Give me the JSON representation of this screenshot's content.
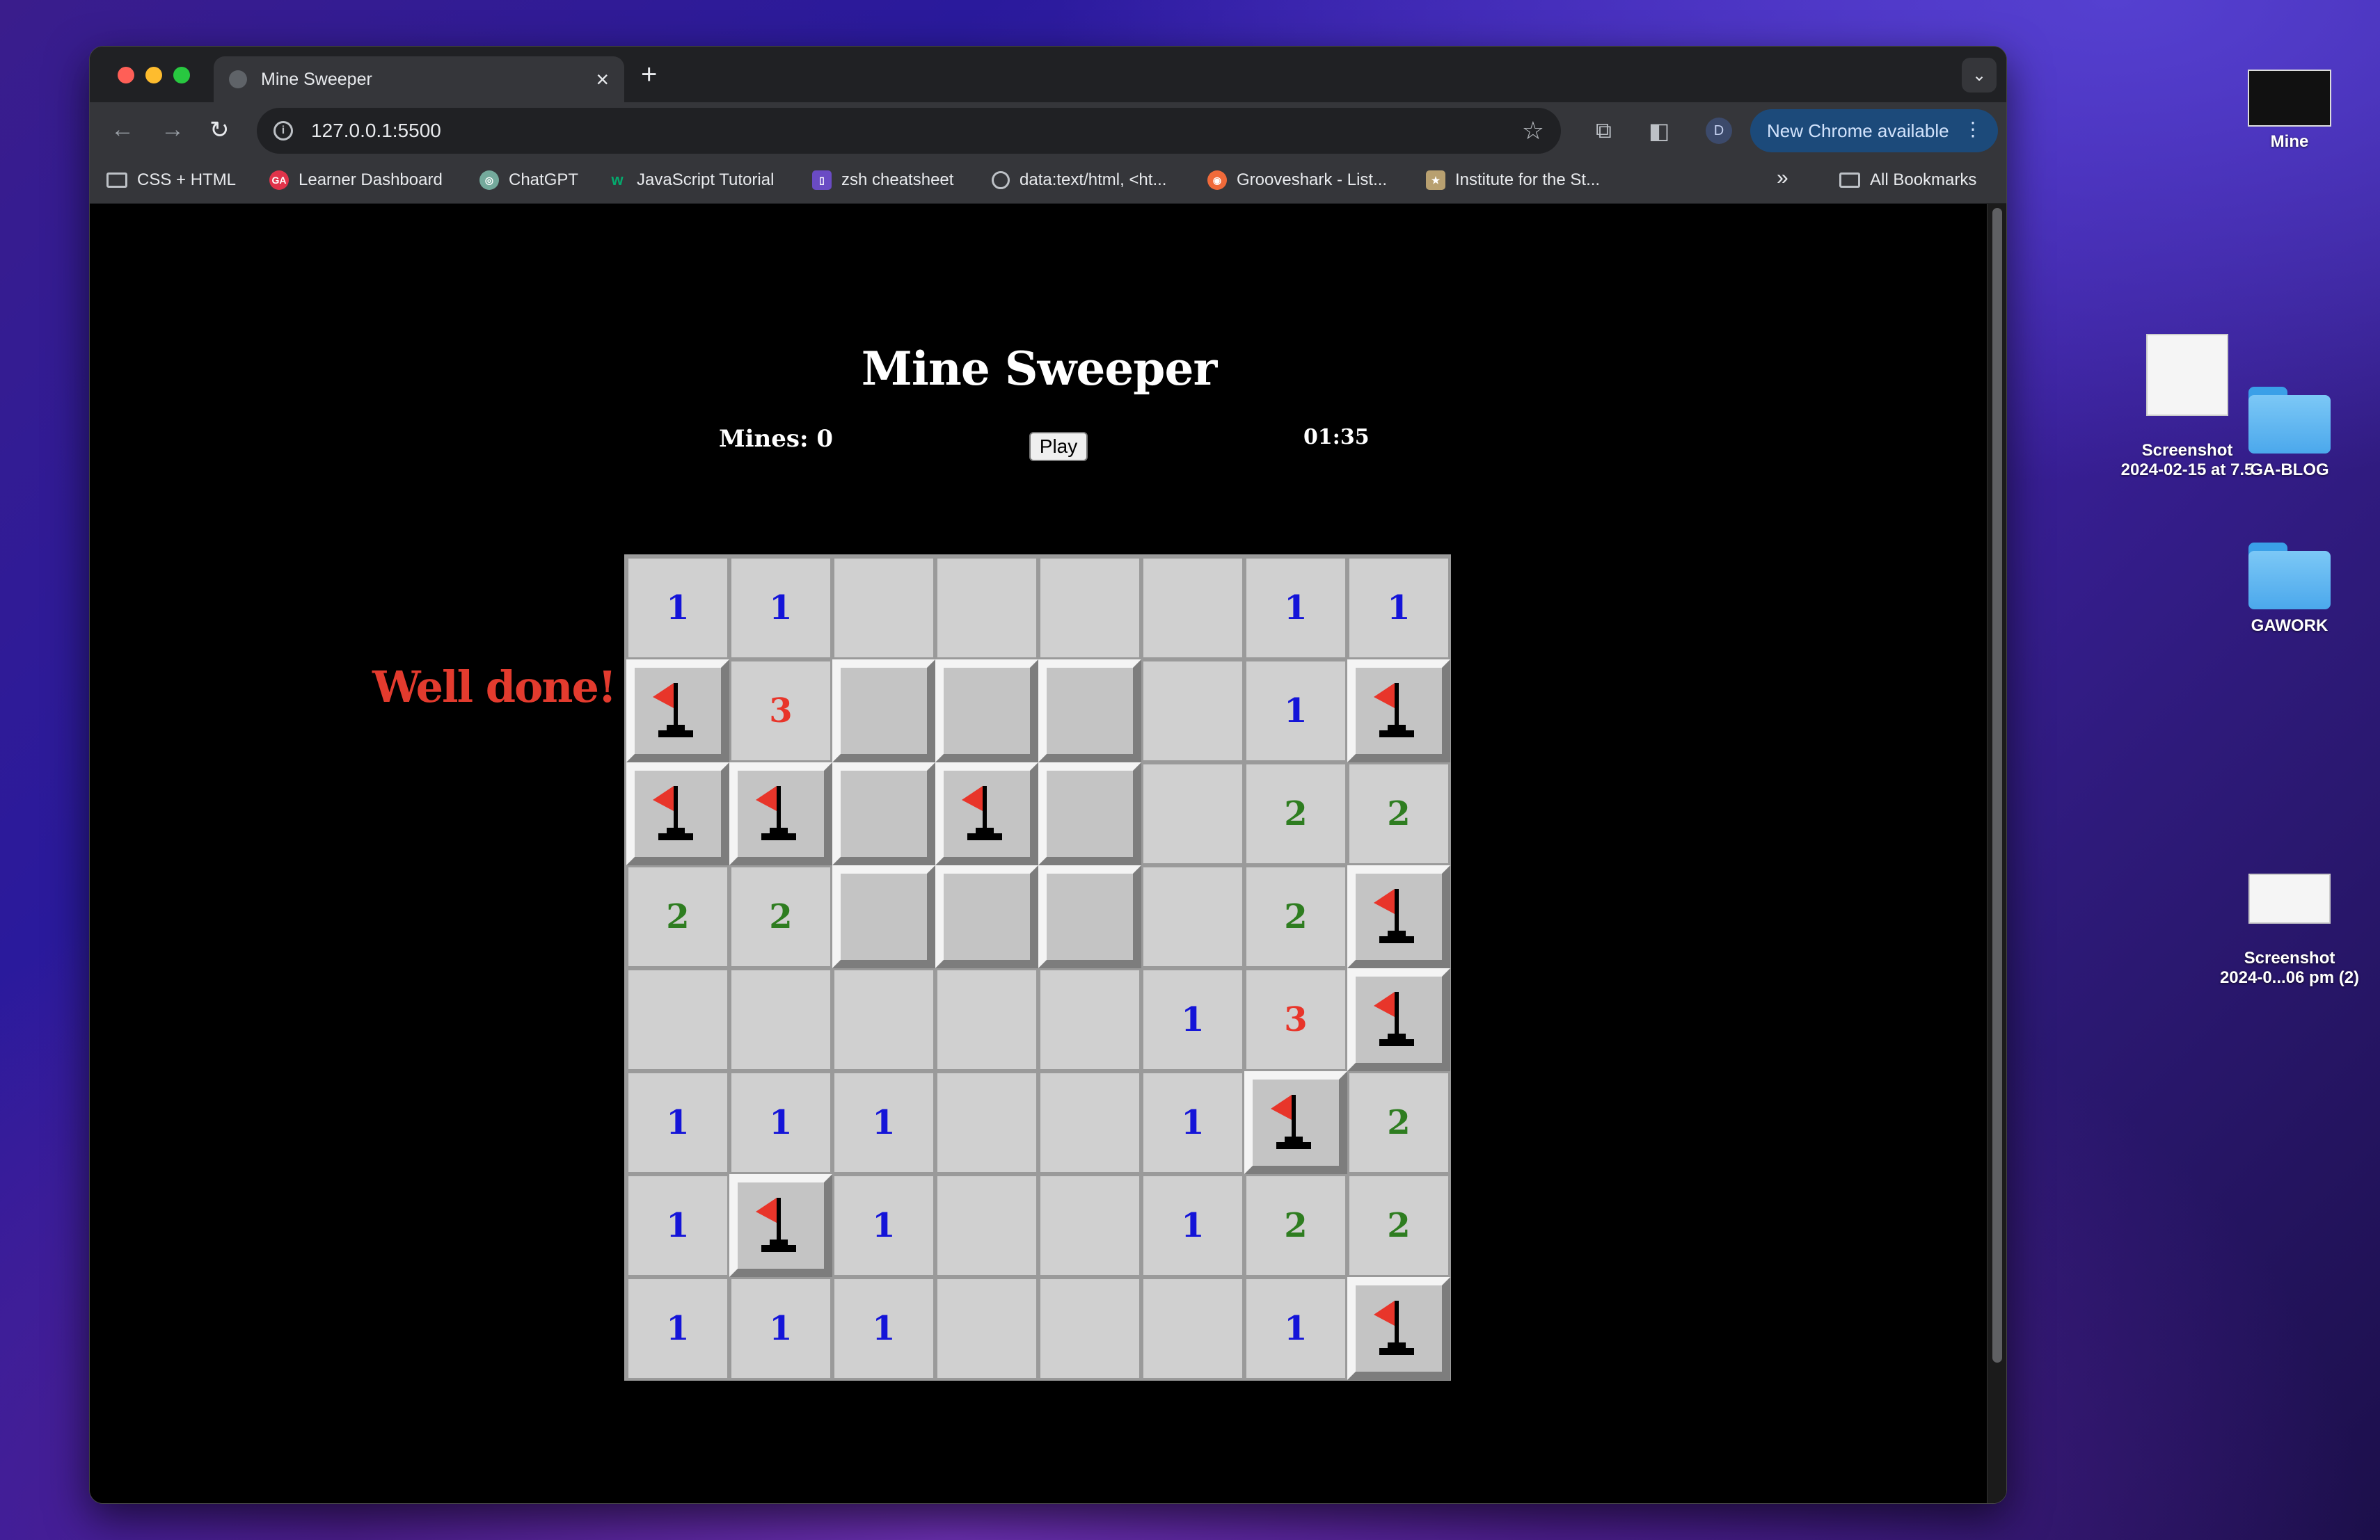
{
  "browser": {
    "tab_title": "Mine Sweeper",
    "tab_close": "×",
    "new_tab": "+",
    "url": "127.0.0.1:5500",
    "update_label": "New Chrome available",
    "profile_initial": "D",
    "bookmarks": [
      {
        "label": "CSS + HTML",
        "icon": "folder-icon"
      },
      {
        "label": "Learner Dashboard",
        "icon": "ga-icon"
      },
      {
        "label": "ChatGPT",
        "icon": "chatgpt-icon"
      },
      {
        "label": "JavaScript Tutorial",
        "icon": "w3-icon"
      },
      {
        "label": "zsh cheatsheet",
        "icon": "zsh-icon"
      },
      {
        "label": "data:text/html, <ht...",
        "icon": "globe-icon"
      },
      {
        "label": "Grooveshark - List...",
        "icon": "grooveshark-icon"
      },
      {
        "label": "Institute for the St...",
        "icon": "institute-icon"
      }
    ],
    "more_bookmarks": "»",
    "all_bookmarks": "All Bookmarks"
  },
  "game": {
    "title": "Mine Sweeper",
    "mines_label": "Mines: 0",
    "play_label": "Play",
    "timer": "01:35",
    "message": "Well done!",
    "colors": {
      "one": "#1414d8",
      "two": "#2e7d20",
      "three": "#e8352a",
      "flag": "#e8352a"
    },
    "board": [
      [
        "1",
        "1",
        "",
        "",
        "",
        "",
        "1",
        "1"
      ],
      [
        "F",
        "3",
        "#",
        "#",
        "#",
        "",
        "1",
        "F"
      ],
      [
        "F",
        "F",
        "#",
        "F",
        "#",
        "",
        "2",
        "2"
      ],
      [
        "2",
        "2",
        "#",
        "#",
        "#",
        "",
        "2",
        "F"
      ],
      [
        "",
        "",
        "",
        "",
        "",
        "1",
        "3",
        "F"
      ],
      [
        "1",
        "1",
        "1",
        "",
        "",
        "1",
        "F",
        "2"
      ],
      [
        "1",
        "F",
        "1",
        "",
        "",
        "1",
        "2",
        "2"
      ],
      [
        "1",
        "1",
        "1",
        "",
        "",
        "",
        "1",
        "F"
      ]
    ]
  },
  "desktop": {
    "items": [
      {
        "label": "Mine",
        "kind": "screenshot"
      },
      {
        "label": "Screenshot\n2024-02-15 at 7.5",
        "kind": "screenshot"
      },
      {
        "label": "GA-BLOG",
        "kind": "folder"
      },
      {
        "label": "GAWORK",
        "kind": "folder"
      },
      {
        "label": "Screenshot\n2024-0...06 pm (2)",
        "kind": "screenshot"
      }
    ]
  }
}
